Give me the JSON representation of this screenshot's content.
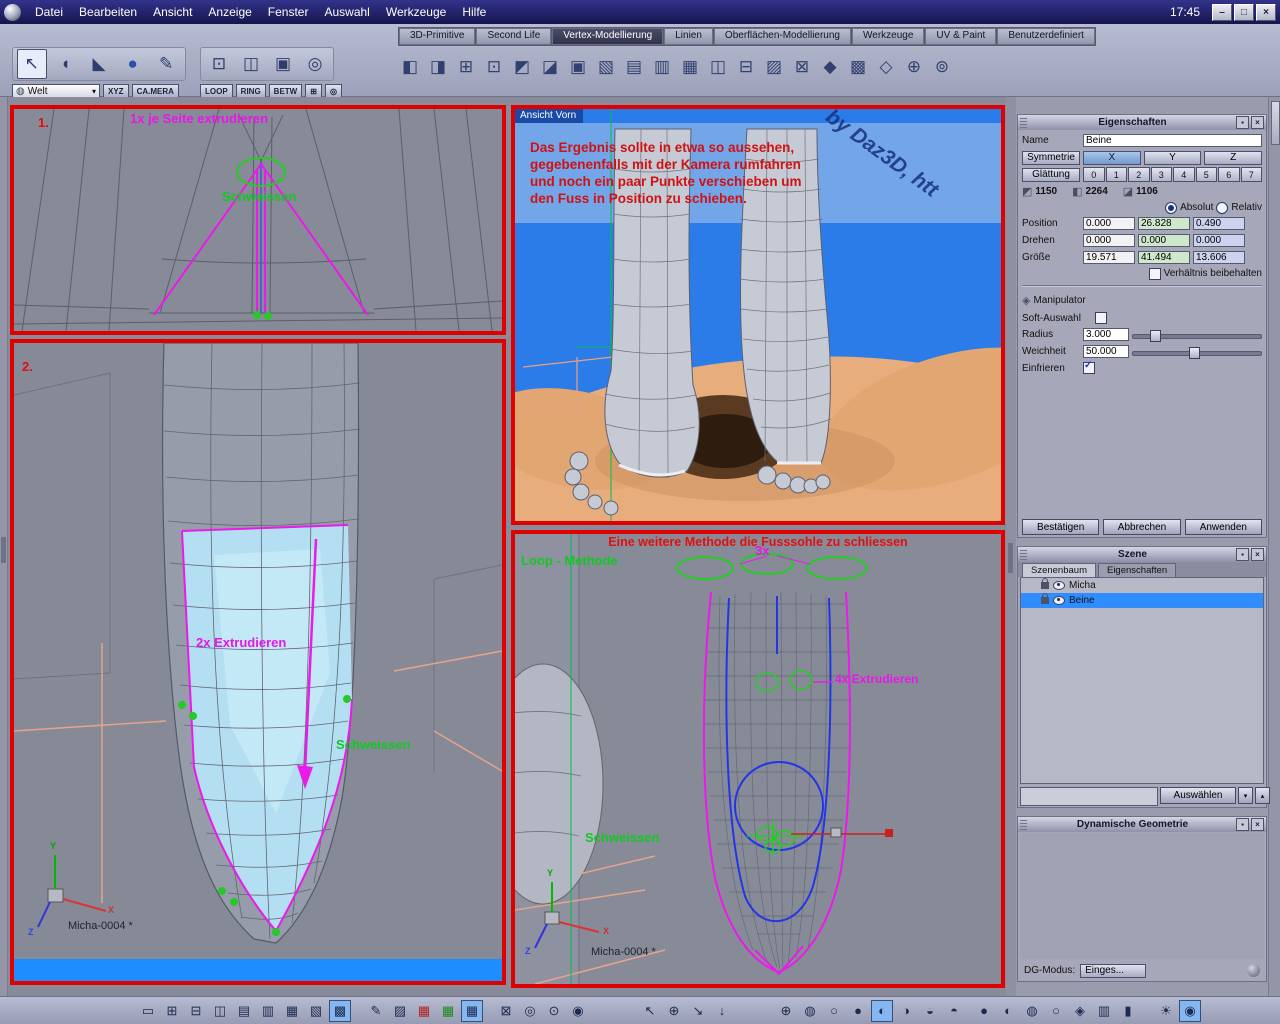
{
  "clock": "17:45",
  "menubar": {
    "items": [
      "Datei",
      "Bearbeiten",
      "Ansicht",
      "Anzeige",
      "Fenster",
      "Auswahl",
      "Werkzeuge",
      "Hilfe"
    ]
  },
  "window_controls": {
    "minimize": "–",
    "maximize": "□",
    "close": "×"
  },
  "tabs": {
    "items": [
      "3D-Primitive",
      "Second Life",
      "Vertex-Modellierung",
      "Linien",
      "Oberflächen-Modellierung",
      "Werkzeuge",
      "UV & Paint",
      "Benutzerdefiniert"
    ],
    "active": "Vertex-Modellierung"
  },
  "toolbar": {
    "world_label": "Welt",
    "xyz_label": "XYZ",
    "camera_label": "CA.MERA",
    "loop_label": "LOOP",
    "ring_label": "RING",
    "betw_label": "BETW",
    "select_tools": [
      {
        "name": "select-arrow",
        "glyph": "↖"
      },
      {
        "name": "lasso-select",
        "glyph": "◖"
      },
      {
        "name": "face-select",
        "glyph": "◣"
      },
      {
        "name": "sphere-select",
        "glyph": "●"
      },
      {
        "name": "paint-select",
        "glyph": "✎"
      }
    ],
    "edge_tools": [
      {
        "name": "edge-tool",
        "glyph": "⊡"
      },
      {
        "name": "loop-tool",
        "glyph": "◫"
      },
      {
        "name": "ring-tool",
        "glyph": "▣"
      },
      {
        "name": "between-tool",
        "glyph": "◎"
      }
    ],
    "extra_buttons": [
      {
        "name": "grid-snap",
        "glyph": "⊞"
      },
      {
        "name": "target-snap",
        "glyph": "◎"
      }
    ],
    "tools": [
      {
        "name": "box-mode",
        "glyph": "◧"
      },
      {
        "name": "rotate-cube",
        "glyph": "◨"
      },
      {
        "name": "copy-cube",
        "glyph": "⊞"
      },
      {
        "name": "extrude-face",
        "glyph": "⊡"
      },
      {
        "name": "extrude-edge",
        "glyph": "◩"
      },
      {
        "name": "sweep",
        "glyph": "◪"
      },
      {
        "name": "smooth",
        "glyph": "▣"
      },
      {
        "name": "cut",
        "glyph": "▧"
      },
      {
        "name": "bridge",
        "glyph": "▤"
      },
      {
        "name": "loop-cut",
        "glyph": "▥"
      },
      {
        "name": "weld",
        "glyph": "▦"
      },
      {
        "name": "mirror",
        "glyph": "◫"
      },
      {
        "name": "symmetry",
        "glyph": "⊟"
      },
      {
        "name": "thickness",
        "glyph": "▨"
      },
      {
        "name": "boolean",
        "glyph": "⊠"
      },
      {
        "name": "bevel",
        "glyph": "◆"
      },
      {
        "name": "lattice",
        "glyph": "▩"
      },
      {
        "name": "deform",
        "glyph": "◇"
      },
      {
        "name": "magnet",
        "glyph": "⊕"
      },
      {
        "name": "settings",
        "glyph": "⊚"
      }
    ]
  },
  "viewport": {
    "panel_top_left": {
      "step_label": "1.",
      "extrude_label": "1x je Seite extrudieren",
      "weld_label": "Schweissen"
    },
    "panel_bottom_left": {
      "step_label": "2.",
      "extrude_label": "2x Extrudieren",
      "weld_label": "Schweissen",
      "doc_label": "Micha-0004 *"
    },
    "panel_top_right": {
      "view_label": "Ansicht Vorn",
      "note_lines": [
        "Das Ergebnis sollte in etwa so aussehen,",
        "gegebenenfalls mit der Kamera rumfahren",
        "und noch ein paar Punkte verschieben um",
        "den Fuss in Position zu schieben."
      ],
      "watermark": "by Daz3D, htt"
    },
    "panel_bottom_right": {
      "title": "Eine weitere Methode die Fusssohle zu schliessen",
      "loop_label": "Loop - Methode",
      "count_label": "3x",
      "extrude_label": "4x Extrudieren",
      "weld_label": "Schweissen",
      "doc_label": "Micha-0004 *"
    },
    "axis_labels": {
      "x": "X",
      "y": "Y",
      "z": "Z"
    }
  },
  "properties": {
    "title": "Eigenschaften",
    "name_label": "Name",
    "name_value": "Beine",
    "symmetry_label": "Symmetrie",
    "axis_x": "X",
    "axis_y": "Y",
    "axis_z": "Z",
    "smoothing_label": "Glättung",
    "smoothing_levels": [
      "0",
      "1",
      "2",
      "3",
      "4",
      "5",
      "6",
      "7"
    ],
    "vertex_count": "1150",
    "edge_count": "2264",
    "face_count": "1106",
    "absolute_label": "Absolut",
    "relative_label": "Relativ",
    "position_label": "Position",
    "rotation_label": "Drehen",
    "size_label": "Größe",
    "position": {
      "x": "0.000",
      "y": "26.828",
      "z": "0.490"
    },
    "rotation": {
      "x": "0.000",
      "y": "0.000",
      "z": "0.000"
    },
    "size": {
      "x": "19.571",
      "y": "41.494",
      "z": "13.606"
    },
    "keep_ratio_label": "Verhältnis beibehalten",
    "manipulator_label": "Manipulator",
    "soft_selection_label": "Soft-Auswahl",
    "radius_label": "Radius",
    "radius_value": "3.000",
    "softness_label": "Weichheit",
    "softness_value": "50.000",
    "freeze_label": "Einfrieren",
    "confirm_label": "Bestätigen",
    "cancel_label": "Abbrechen",
    "apply_label": "Anwenden"
  },
  "scene": {
    "title": "Szene",
    "tab_tree": "Szenenbaum",
    "tab_props": "Eigenschaften",
    "items": [
      {
        "label": "Micha",
        "selected": false
      },
      {
        "label": "Beine",
        "selected": true
      }
    ],
    "select_label": "Auswählen"
  },
  "dynamic_geometry": {
    "title": "Dynamische Geometrie",
    "mode_label": "DG-Modus:",
    "mode_value": "Einges..."
  },
  "icons": {
    "dropdown_arrow": "▾",
    "up_arrow": "▴",
    "down_arrow": "▾",
    "panel_pin": "▪",
    "panel_close": "×",
    "globe": "◍",
    "vertex_badge": "◩",
    "edge_badge": "◧",
    "face_badge": "◪",
    "manipulator": "◈"
  },
  "bottombar": {
    "layouts": [
      {
        "name": "layout-single",
        "glyph": "▭"
      },
      {
        "name": "layout-quad",
        "glyph": "⊞"
      },
      {
        "name": "layout-split-h",
        "glyph": "⊟"
      },
      {
        "name": "layout-split-v",
        "glyph": "◫"
      },
      {
        "name": "layout-three-left",
        "glyph": "▤"
      },
      {
        "name": "layout-three-top",
        "glyph": "▥"
      },
      {
        "name": "layout-grid",
        "glyph": "▦"
      },
      {
        "name": "layout-main-right",
        "glyph": "▧"
      },
      {
        "name": "layout-full",
        "glyph": "▩"
      }
    ],
    "paint": [
      {
        "name": "draw",
        "glyph": "✎"
      },
      {
        "name": "fill",
        "glyph": "▨"
      }
    ],
    "grids": [
      {
        "name": "grid-x",
        "glyph": "▦"
      },
      {
        "name": "grid-y",
        "glyph": "▦"
      },
      {
        "name": "grid-z",
        "glyph": "▦"
      }
    ],
    "view": [
      {
        "name": "marquee",
        "glyph": "⊠"
      },
      {
        "name": "hide",
        "glyph": "◎"
      },
      {
        "name": "zoom",
        "glyph": "⊙"
      },
      {
        "name": "visibility",
        "glyph": "◉"
      }
    ],
    "nav": [
      {
        "name": "cursor-tool",
        "glyph": "↖"
      },
      {
        "name": "pan-tool",
        "glyph": "⊕"
      },
      {
        "name": "orbit-tool",
        "glyph": "↘"
      },
      {
        "name": "dolly-tool",
        "glyph": "↓"
      }
    ],
    "display": [
      {
        "name": "axes-globe",
        "glyph": "⊕"
      },
      {
        "name": "material-globe",
        "glyph": "◍"
      },
      {
        "name": "outline-sphere",
        "glyph": "○"
      },
      {
        "name": "shaded-sphere",
        "glyph": "●"
      },
      {
        "name": "light-sphere",
        "glyph": "◐"
      },
      {
        "name": "dark-sphere",
        "glyph": "◑"
      },
      {
        "name": "bottom-sphere",
        "glyph": "◒"
      },
      {
        "name": "top-sphere",
        "glyph": "◓"
      }
    ],
    "shading": [
      {
        "name": "smooth-shade",
        "glyph": "●"
      },
      {
        "name": "flat-shade",
        "glyph": "◐"
      },
      {
        "name": "textured-shade",
        "glyph": "◍"
      },
      {
        "name": "wire-shade",
        "glyph": "○"
      }
    ],
    "misc": [
      {
        "name": "gizmo-toggle",
        "glyph": "◈"
      },
      {
        "name": "panel-toggle",
        "glyph": "▥"
      },
      {
        "name": "pause-toggle",
        "glyph": "▮"
      }
    ],
    "render": [
      {
        "name": "light-toggle",
        "glyph": "☀"
      },
      {
        "name": "camera-view",
        "glyph": "◉"
      }
    ]
  }
}
